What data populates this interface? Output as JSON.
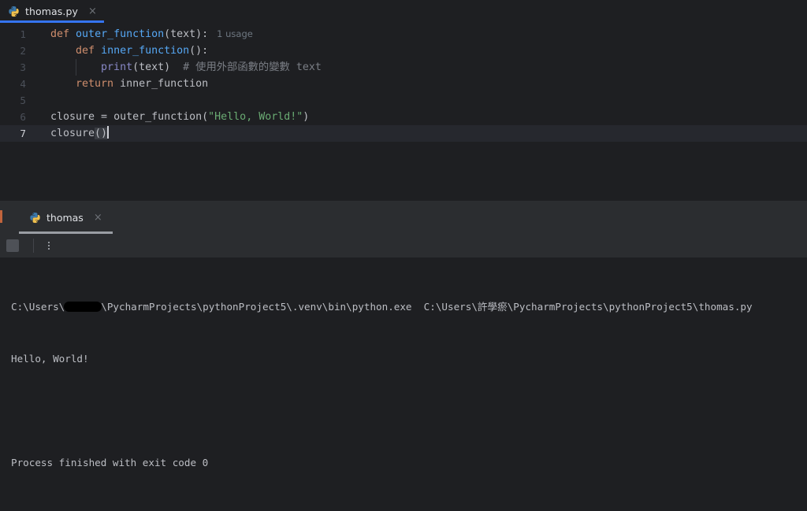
{
  "editor": {
    "tab": {
      "filename": "thomas.py",
      "icon": "python-file-icon",
      "close_label": "×"
    },
    "accent_color": "#3574F0",
    "background": "#1E1F22",
    "current_line": 7,
    "lines": [
      {
        "number": "1",
        "tokens": [
          {
            "t": "def",
            "c": "kw"
          },
          {
            "t": " ",
            "c": "pl"
          },
          {
            "t": "outer_function",
            "c": "fn"
          },
          {
            "t": "(text):",
            "c": "pl"
          }
        ],
        "inlay_hint": "1 usage"
      },
      {
        "number": "2",
        "tokens": [
          {
            "t": "    ",
            "c": "pl"
          },
          {
            "t": "def",
            "c": "kw"
          },
          {
            "t": " ",
            "c": "pl"
          },
          {
            "t": "inner_function",
            "c": "fn"
          },
          {
            "t": "():",
            "c": "pl"
          }
        ],
        "inlay_hint": ""
      },
      {
        "number": "3",
        "tokens": [
          {
            "t": "        ",
            "c": "pl"
          },
          {
            "t": "print",
            "c": "bi"
          },
          {
            "t": "(text)",
            "c": "pl"
          },
          {
            "t": "  # ",
            "c": "cmt"
          },
          {
            "t": "使用外部函數的變數",
            "c": "cmt cjk"
          },
          {
            "t": " text",
            "c": "cmt"
          }
        ],
        "inlay_hint": ""
      },
      {
        "number": "4",
        "tokens": [
          {
            "t": "    ",
            "c": "pl"
          },
          {
            "t": "return",
            "c": "kw"
          },
          {
            "t": " inner_function",
            "c": "pl"
          }
        ],
        "inlay_hint": ""
      },
      {
        "number": "5",
        "tokens": [],
        "inlay_hint": ""
      },
      {
        "number": "6",
        "tokens": [
          {
            "t": "closure = ",
            "c": "pl"
          },
          {
            "t": "outer_function",
            "c": "pl"
          },
          {
            "t": "(",
            "c": "pl"
          },
          {
            "t": "\"Hello, World!\"",
            "c": "str"
          },
          {
            "t": ")",
            "c": "pl"
          }
        ],
        "inlay_hint": ""
      },
      {
        "number": "7",
        "tokens": [
          {
            "t": "closure",
            "c": "pl"
          },
          {
            "t": "()",
            "c": "pl brmatch"
          }
        ],
        "inlay_hint": ""
      }
    ]
  },
  "run_window": {
    "tab": {
      "title": "thomas",
      "icon": "python-run-icon",
      "close_label": "×"
    },
    "toolbar": {
      "stop_button": "stop",
      "more_button": "more-options"
    },
    "console": {
      "command_prefix": "C:\\Users\\",
      "command_suffix": "\\PycharmProjects\\pythonProject5\\.venv\\bin\\python.exe  C:\\Users\\許學瘀\\PycharmProjects\\pythonProject5\\thomas.py",
      "output": "Hello, World!",
      "exit_message": "Process finished with exit code 0"
    }
  }
}
